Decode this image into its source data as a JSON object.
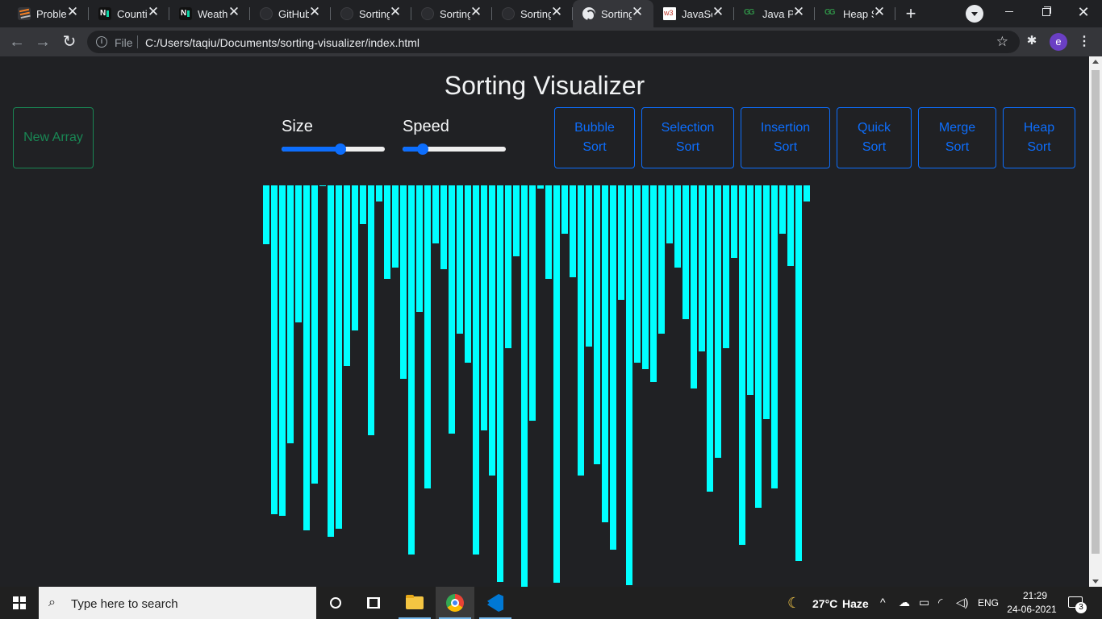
{
  "browser": {
    "tabs": [
      {
        "title": "Problem",
        "favicon": "stackoverflow-icon",
        "active": false
      },
      {
        "title": "Counting",
        "favicon": "namecheap-icon",
        "active": false
      },
      {
        "title": "Weather",
        "favicon": "namecheap-icon",
        "active": false
      },
      {
        "title": "GitHub",
        "favicon": "github-icon",
        "active": false
      },
      {
        "title": "Sorting",
        "favicon": "github-icon",
        "active": false
      },
      {
        "title": "Sorting",
        "favicon": "github-icon",
        "active": false
      },
      {
        "title": "Sorting",
        "favicon": "github-icon",
        "active": false
      },
      {
        "title": "Sorting",
        "favicon": "globe-icon",
        "active": true
      },
      {
        "title": "JavaScript",
        "favicon": "w3schools-icon",
        "active": false
      },
      {
        "title": "Java Program",
        "favicon": "geeksforgeeks-icon",
        "active": false
      },
      {
        "title": "Heap Sort",
        "favicon": "geeksforgeeks-icon",
        "active": false
      }
    ],
    "address": {
      "scheme_label": "File",
      "url": "C:/Users/taqiu/Documents/sorting-visualizer/index.html"
    },
    "profile_initial": "e"
  },
  "page": {
    "title": "Sorting Visualizer",
    "new_array_label": "New Array",
    "size_label": "Size",
    "speed_label": "Speed",
    "size_value_fraction": 0.58,
    "speed_value_fraction": 0.16,
    "algorithms": [
      {
        "line1": "Bubble",
        "line2": "Sort"
      },
      {
        "line1": "Selection",
        "line2": "Sort"
      },
      {
        "line1": "Insertion",
        "line2": "Sort"
      },
      {
        "line1": "Quick",
        "line2": "Sort"
      },
      {
        "line1": "Merge",
        "line2": "Sort"
      },
      {
        "line1": "Heap",
        "line2": "Sort"
      }
    ],
    "colors": {
      "bar": "#00ffff",
      "primary": "#0d6efd",
      "success": "#198754",
      "background": "#202124"
    },
    "array_values": [
      73,
      408,
      410,
      320,
      170,
      428,
      370,
      1,
      436,
      426,
      224,
      180,
      48,
      310,
      20,
      116,
      102,
      240,
      458,
      157,
      376,
      72,
      104,
      308,
      184,
      220,
      458,
      304,
      360,
      492,
      202,
      88,
      500,
      292,
      4,
      116,
      493,
      60,
      114,
      360,
      200,
      346,
      418,
      452,
      142,
      496,
      220,
      228,
      244,
      184,
      72,
      102,
      166,
      252,
      206,
      380,
      338,
      202,
      90,
      446,
      260,
      400,
      290,
      376,
      60,
      100,
      466,
      20
    ]
  },
  "taskbar": {
    "search_placeholder": "Type here to search",
    "temperature": "27°C",
    "weather": "Haze",
    "language": "ENG",
    "time": "21:29",
    "date": "24-06-2021",
    "notification_count": "3"
  }
}
